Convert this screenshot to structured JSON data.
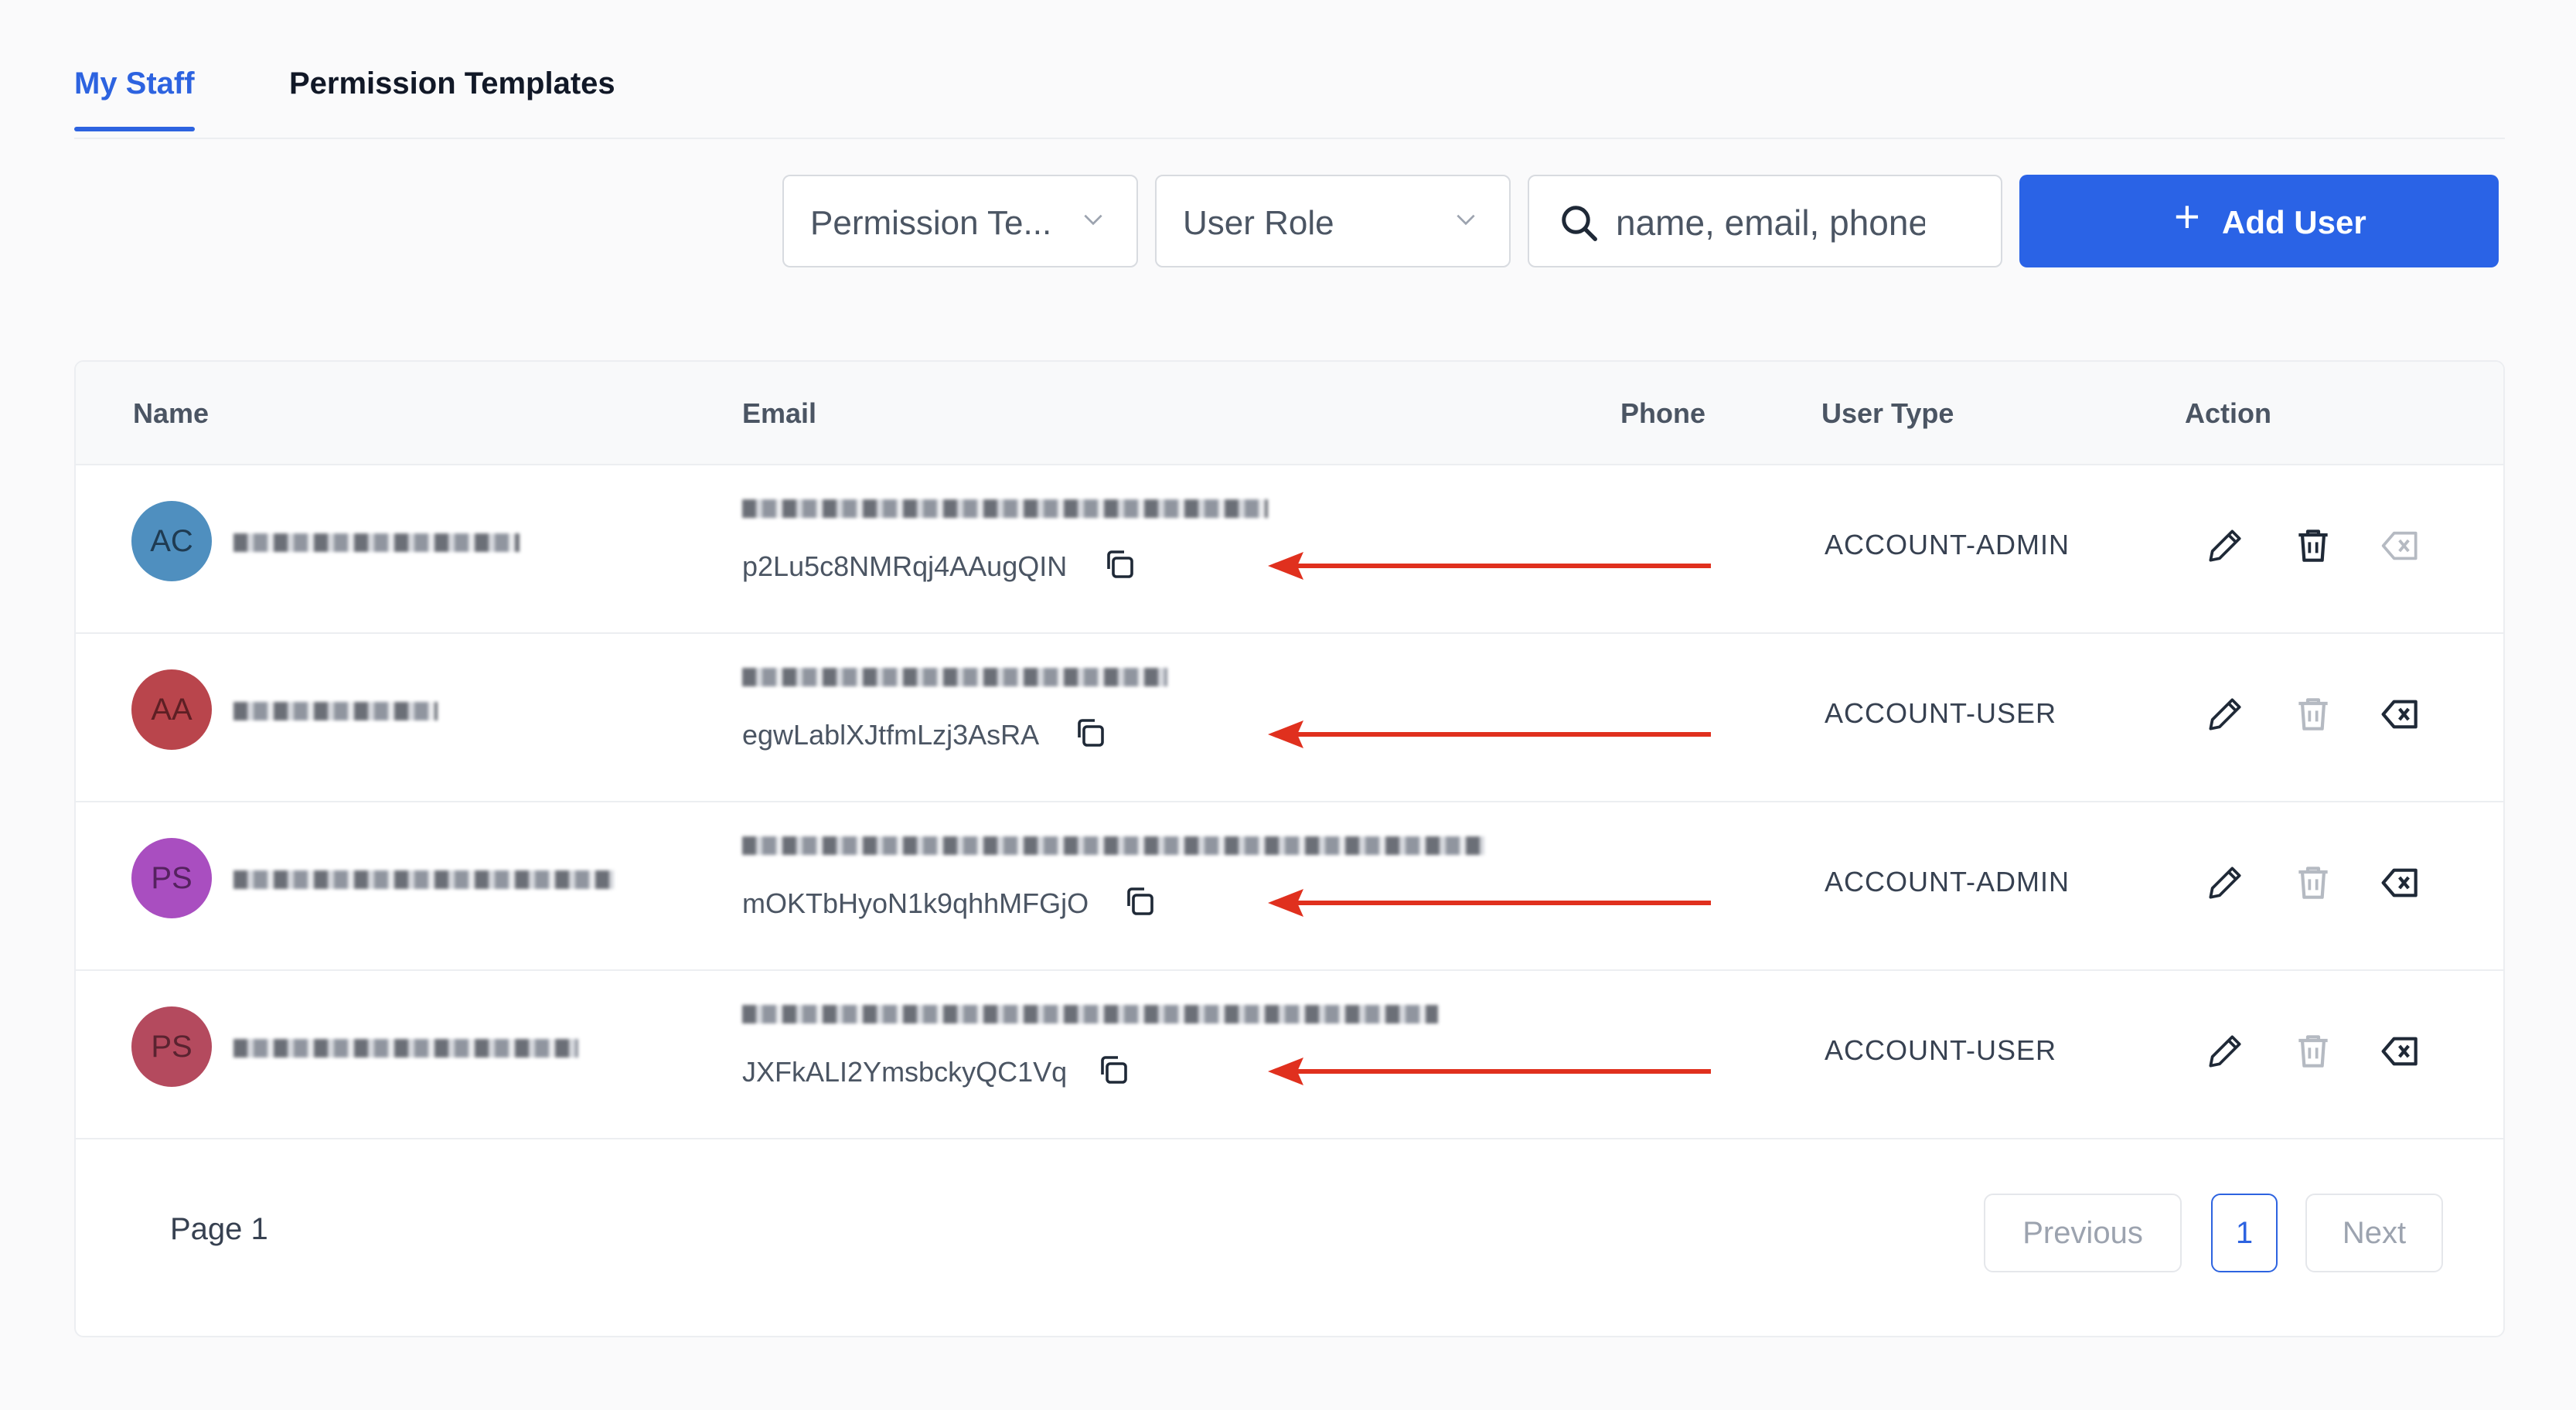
{
  "tabs": [
    {
      "label": "My Staff",
      "active": true
    },
    {
      "label": "Permission Templates",
      "active": false
    }
  ],
  "toolbar": {
    "permission_template_select": "Permission Te...",
    "user_role_select": "User Role",
    "search_placeholder": "name, email, phone",
    "add_user_label": "Add User",
    "add_user_icon": "+"
  },
  "table": {
    "columns": [
      "Name",
      "Email",
      "Phone",
      "User Type",
      "Action"
    ],
    "rows": [
      {
        "initials": "AC",
        "avatar_color": "#4f8fbf",
        "name_redacted": true,
        "email_redacted": true,
        "secret": "p2Lu5c8NMRqj4AAugQIN",
        "phone": "",
        "user_type": "ACCOUNT-ADMIN",
        "delete_enabled": true,
        "remove_enabled": false
      },
      {
        "initials": "AA",
        "avatar_color": "#b9454c",
        "name_redacted": true,
        "email_redacted": true,
        "secret": "egwLablXJtfmLzj3AsRA",
        "phone": "",
        "user_type": "ACCOUNT-USER",
        "delete_enabled": false,
        "remove_enabled": true
      },
      {
        "initials": "PS",
        "avatar_color": "#a94ec0",
        "name_redacted": true,
        "email_redacted": true,
        "secret": "mOKTbHyoN1k9qhhMFGjO",
        "phone": "",
        "user_type": "ACCOUNT-ADMIN",
        "delete_enabled": false,
        "remove_enabled": true
      },
      {
        "initials": "PS",
        "avatar_color": "#b44a5e",
        "name_redacted": true,
        "email_redacted": true,
        "secret": "JXFkALI2YmsbckyQC1Vq",
        "phone": "",
        "user_type": "ACCOUNT-USER",
        "delete_enabled": false,
        "remove_enabled": true
      }
    ]
  },
  "pagination": {
    "page_label": "Page 1",
    "previous": "Previous",
    "current_page": "1",
    "next": "Next"
  },
  "colors": {
    "accent": "#2d63e0",
    "annotation_arrow": "#e0301e"
  },
  "icons": [
    "search-icon",
    "chevron-down-icon",
    "copy-icon",
    "edit-icon",
    "trash-icon",
    "remove-icon",
    "plus-icon"
  ]
}
